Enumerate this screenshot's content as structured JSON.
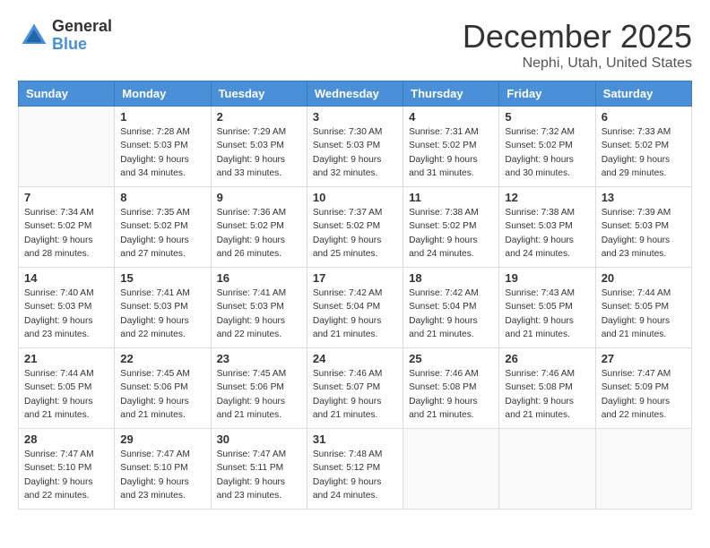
{
  "logo": {
    "general": "General",
    "blue": "Blue"
  },
  "title": "December 2025",
  "location": "Nephi, Utah, United States",
  "weekdays": [
    "Sunday",
    "Monday",
    "Tuesday",
    "Wednesday",
    "Thursday",
    "Friday",
    "Saturday"
  ],
  "weeks": [
    [
      {
        "day": "",
        "info": ""
      },
      {
        "day": "1",
        "info": "Sunrise: 7:28 AM\nSunset: 5:03 PM\nDaylight: 9 hours\nand 34 minutes."
      },
      {
        "day": "2",
        "info": "Sunrise: 7:29 AM\nSunset: 5:03 PM\nDaylight: 9 hours\nand 33 minutes."
      },
      {
        "day": "3",
        "info": "Sunrise: 7:30 AM\nSunset: 5:03 PM\nDaylight: 9 hours\nand 32 minutes."
      },
      {
        "day": "4",
        "info": "Sunrise: 7:31 AM\nSunset: 5:02 PM\nDaylight: 9 hours\nand 31 minutes."
      },
      {
        "day": "5",
        "info": "Sunrise: 7:32 AM\nSunset: 5:02 PM\nDaylight: 9 hours\nand 30 minutes."
      },
      {
        "day": "6",
        "info": "Sunrise: 7:33 AM\nSunset: 5:02 PM\nDaylight: 9 hours\nand 29 minutes."
      }
    ],
    [
      {
        "day": "7",
        "info": "Sunrise: 7:34 AM\nSunset: 5:02 PM\nDaylight: 9 hours\nand 28 minutes."
      },
      {
        "day": "8",
        "info": "Sunrise: 7:35 AM\nSunset: 5:02 PM\nDaylight: 9 hours\nand 27 minutes."
      },
      {
        "day": "9",
        "info": "Sunrise: 7:36 AM\nSunset: 5:02 PM\nDaylight: 9 hours\nand 26 minutes."
      },
      {
        "day": "10",
        "info": "Sunrise: 7:37 AM\nSunset: 5:02 PM\nDaylight: 9 hours\nand 25 minutes."
      },
      {
        "day": "11",
        "info": "Sunrise: 7:38 AM\nSunset: 5:02 PM\nDaylight: 9 hours\nand 24 minutes."
      },
      {
        "day": "12",
        "info": "Sunrise: 7:38 AM\nSunset: 5:03 PM\nDaylight: 9 hours\nand 24 minutes."
      },
      {
        "day": "13",
        "info": "Sunrise: 7:39 AM\nSunset: 5:03 PM\nDaylight: 9 hours\nand 23 minutes."
      }
    ],
    [
      {
        "day": "14",
        "info": "Sunrise: 7:40 AM\nSunset: 5:03 PM\nDaylight: 9 hours\nand 23 minutes."
      },
      {
        "day": "15",
        "info": "Sunrise: 7:41 AM\nSunset: 5:03 PM\nDaylight: 9 hours\nand 22 minutes."
      },
      {
        "day": "16",
        "info": "Sunrise: 7:41 AM\nSunset: 5:03 PM\nDaylight: 9 hours\nand 22 minutes."
      },
      {
        "day": "17",
        "info": "Sunrise: 7:42 AM\nSunset: 5:04 PM\nDaylight: 9 hours\nand 21 minutes."
      },
      {
        "day": "18",
        "info": "Sunrise: 7:42 AM\nSunset: 5:04 PM\nDaylight: 9 hours\nand 21 minutes."
      },
      {
        "day": "19",
        "info": "Sunrise: 7:43 AM\nSunset: 5:05 PM\nDaylight: 9 hours\nand 21 minutes."
      },
      {
        "day": "20",
        "info": "Sunrise: 7:44 AM\nSunset: 5:05 PM\nDaylight: 9 hours\nand 21 minutes."
      }
    ],
    [
      {
        "day": "21",
        "info": "Sunrise: 7:44 AM\nSunset: 5:05 PM\nDaylight: 9 hours\nand 21 minutes."
      },
      {
        "day": "22",
        "info": "Sunrise: 7:45 AM\nSunset: 5:06 PM\nDaylight: 9 hours\nand 21 minutes."
      },
      {
        "day": "23",
        "info": "Sunrise: 7:45 AM\nSunset: 5:06 PM\nDaylight: 9 hours\nand 21 minutes."
      },
      {
        "day": "24",
        "info": "Sunrise: 7:46 AM\nSunset: 5:07 PM\nDaylight: 9 hours\nand 21 minutes."
      },
      {
        "day": "25",
        "info": "Sunrise: 7:46 AM\nSunset: 5:08 PM\nDaylight: 9 hours\nand 21 minutes."
      },
      {
        "day": "26",
        "info": "Sunrise: 7:46 AM\nSunset: 5:08 PM\nDaylight: 9 hours\nand 21 minutes."
      },
      {
        "day": "27",
        "info": "Sunrise: 7:47 AM\nSunset: 5:09 PM\nDaylight: 9 hours\nand 22 minutes."
      }
    ],
    [
      {
        "day": "28",
        "info": "Sunrise: 7:47 AM\nSunset: 5:10 PM\nDaylight: 9 hours\nand 22 minutes."
      },
      {
        "day": "29",
        "info": "Sunrise: 7:47 AM\nSunset: 5:10 PM\nDaylight: 9 hours\nand 23 minutes."
      },
      {
        "day": "30",
        "info": "Sunrise: 7:47 AM\nSunset: 5:11 PM\nDaylight: 9 hours\nand 23 minutes."
      },
      {
        "day": "31",
        "info": "Sunrise: 7:48 AM\nSunset: 5:12 PM\nDaylight: 9 hours\nand 24 minutes."
      },
      {
        "day": "",
        "info": ""
      },
      {
        "day": "",
        "info": ""
      },
      {
        "day": "",
        "info": ""
      }
    ]
  ]
}
